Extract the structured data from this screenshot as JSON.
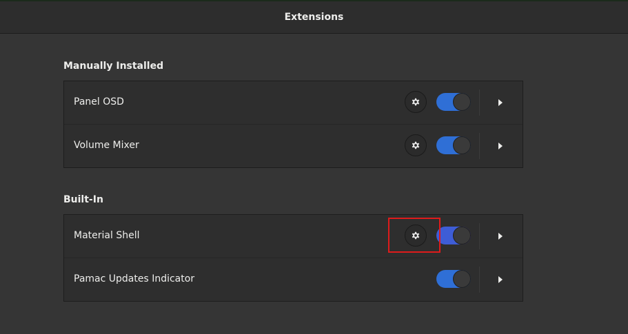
{
  "header": {
    "title": "Extensions"
  },
  "sections": [
    {
      "title": "Manually Installed",
      "items": [
        {
          "label": "Panel OSD",
          "has_settings": true,
          "enabled": true
        },
        {
          "label": "Volume Mixer",
          "has_settings": true,
          "enabled": true
        }
      ]
    },
    {
      "title": "Built-In",
      "items": [
        {
          "label": "Material Shell",
          "has_settings": true,
          "enabled": true
        },
        {
          "label": "Pamac Updates Indicator",
          "has_settings": false,
          "enabled": true
        }
      ]
    }
  ],
  "icons": {
    "settings": "gear-icon",
    "expand": "chevron-right-icon"
  },
  "colors": {
    "switch_on": "#2f6fd6",
    "highlight": "#e01b1b",
    "background": "#353535"
  }
}
